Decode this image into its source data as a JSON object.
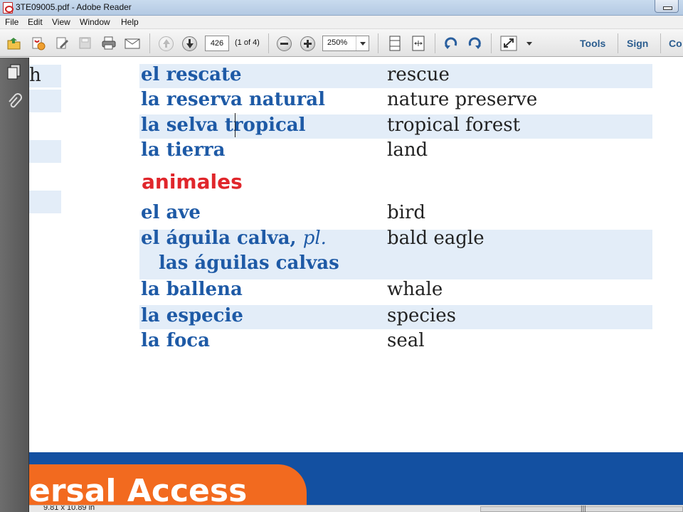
{
  "window": {
    "title": "3TE09005.pdf - Adobe Reader"
  },
  "menu": [
    "File",
    "Edit",
    "View",
    "Window",
    "Help"
  ],
  "toolbar": {
    "page_number": "426",
    "page_count": "(1 of 4)",
    "zoom": "250%",
    "links": [
      "Tools",
      "Sign",
      "Co"
    ]
  },
  "document": {
    "left_stub_text": "h",
    "rows": [
      {
        "es": "el rescate",
        "en": "rescue",
        "shaded": true
      },
      {
        "es": "la reserva natural",
        "en": "nature preserve",
        "shaded": false
      },
      {
        "es": "la selva tropical",
        "en": "tropical forest",
        "shaded": true
      },
      {
        "es": "la tierra",
        "en": "land",
        "shaded": false
      }
    ],
    "section_heading": "animales",
    "animal_rows": [
      {
        "es": "el ave",
        "en": "bird",
        "shaded": false
      },
      {
        "es": "el águila calva,",
        "es_suffix": "pl.",
        "es_line2": "las águilas calvas",
        "en": "bald eagle",
        "shaded": true
      },
      {
        "es": "la ballena",
        "en": "whale",
        "shaded": false
      },
      {
        "es": "la especie",
        "en": "species",
        "shaded": true
      },
      {
        "es": "la foca",
        "en": "seal",
        "shaded": false
      }
    ],
    "banner_text": "ersal Access"
  },
  "status": {
    "page_size": "9.81 x 10.89 in"
  },
  "colors": {
    "term_blue": "#1e5aa6",
    "heading_red": "#e0262b",
    "band_blue": "#1350a1",
    "tab_orange": "#f26a1f",
    "row_shade": "#e3edf8"
  }
}
